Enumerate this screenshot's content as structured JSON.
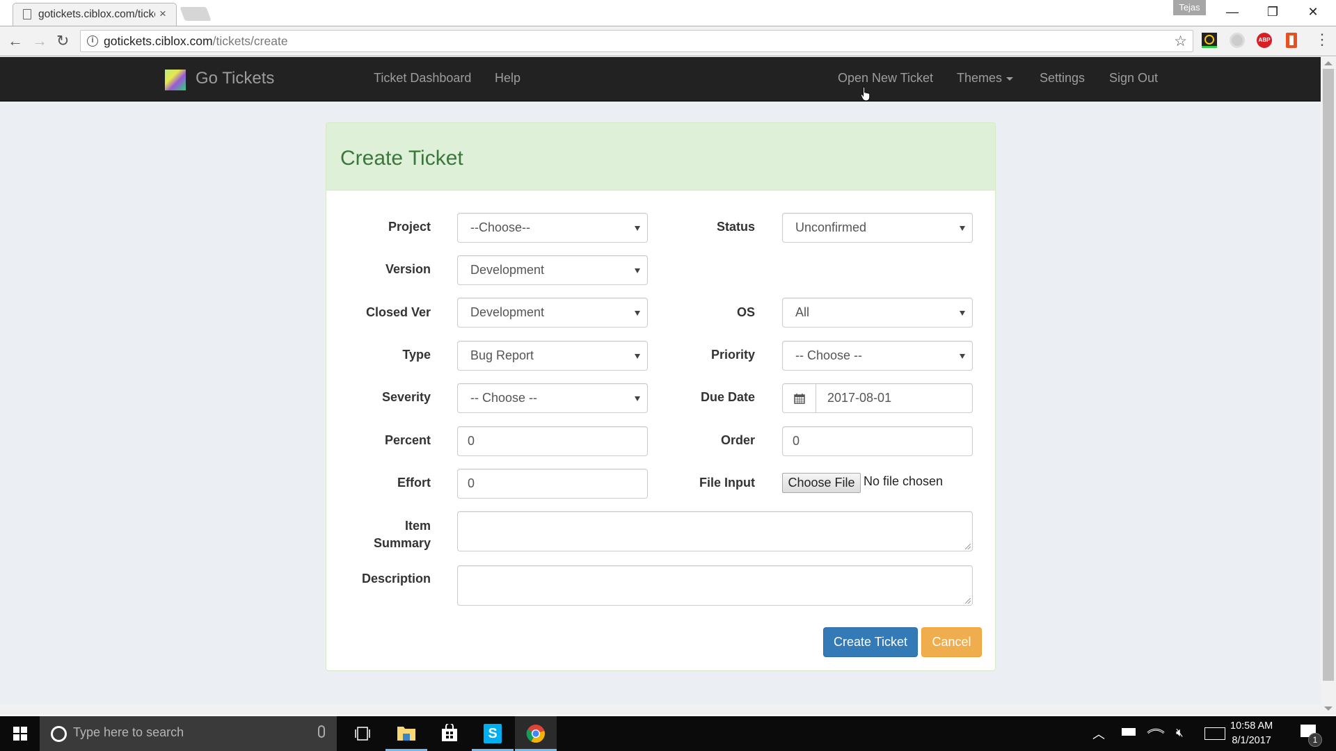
{
  "browser": {
    "tab_title": "gotickets.ciblox.com/tickets/create",
    "tab_close": "×",
    "profile_name": "Tejas",
    "url_host": "gotickets.ciblox.com",
    "url_path": "/tickets/create",
    "window_controls": {
      "minimize": "—",
      "restore": "❐",
      "close": "✕"
    },
    "nav": {
      "back": "←",
      "forward": "→",
      "reload": "↻"
    },
    "info_icon": "i",
    "star": "☆",
    "menu": "⋮",
    "extensions": [
      "norton-safe-web",
      "gray-extension",
      "adblock-plus",
      "office"
    ],
    "abp_label": "ABP"
  },
  "navbar": {
    "brand": "Go Tickets",
    "links": [
      {
        "label": "Ticket Dashboard"
      },
      {
        "label": "Help"
      },
      {
        "label": "Open New Ticket"
      },
      {
        "label": "Themes"
      },
      {
        "label": "Settings"
      },
      {
        "label": "Sign Out"
      }
    ]
  },
  "form": {
    "title": "Create Ticket",
    "fields": {
      "project": {
        "label": "Project",
        "value": "--Choose--"
      },
      "status": {
        "label": "Status",
        "value": "Unconfirmed"
      },
      "version": {
        "label": "Version",
        "value": "Development"
      },
      "closed_ver": {
        "label": "Closed Ver",
        "value": "Development"
      },
      "os": {
        "label": "OS",
        "value": "All"
      },
      "type": {
        "label": "Type",
        "value": "Bug Report"
      },
      "priority": {
        "label": "Priority",
        "value": "-- Choose --"
      },
      "severity": {
        "label": "Severity",
        "value": "-- Choose --"
      },
      "due_date": {
        "label": "Due Date",
        "value": "2017-08-01"
      },
      "percent": {
        "label": "Percent",
        "value": "0"
      },
      "order": {
        "label": "Order",
        "value": "0"
      },
      "effort": {
        "label": "Effort",
        "value": "0"
      },
      "file_input": {
        "label": "File Input",
        "button": "Choose File",
        "status": "No file chosen"
      },
      "item_summary": {
        "label_line1": "Item",
        "label_line2": "Summary",
        "value": ""
      },
      "description": {
        "label": "Description",
        "value": ""
      }
    },
    "buttons": {
      "create": "Create Ticket",
      "cancel": "Cancel"
    },
    "colors": {
      "heading_bg": "#dff0d8",
      "heading_text": "#3c763d",
      "primary": "#337ab7",
      "warning": "#f0ad4e"
    }
  },
  "taskbar": {
    "search_placeholder": "Type here to search",
    "apps": [
      "task-view",
      "file-explorer",
      "store",
      "skype",
      "chrome"
    ],
    "time": "10:58 AM",
    "date": "8/1/2017",
    "notification_count": "1"
  }
}
